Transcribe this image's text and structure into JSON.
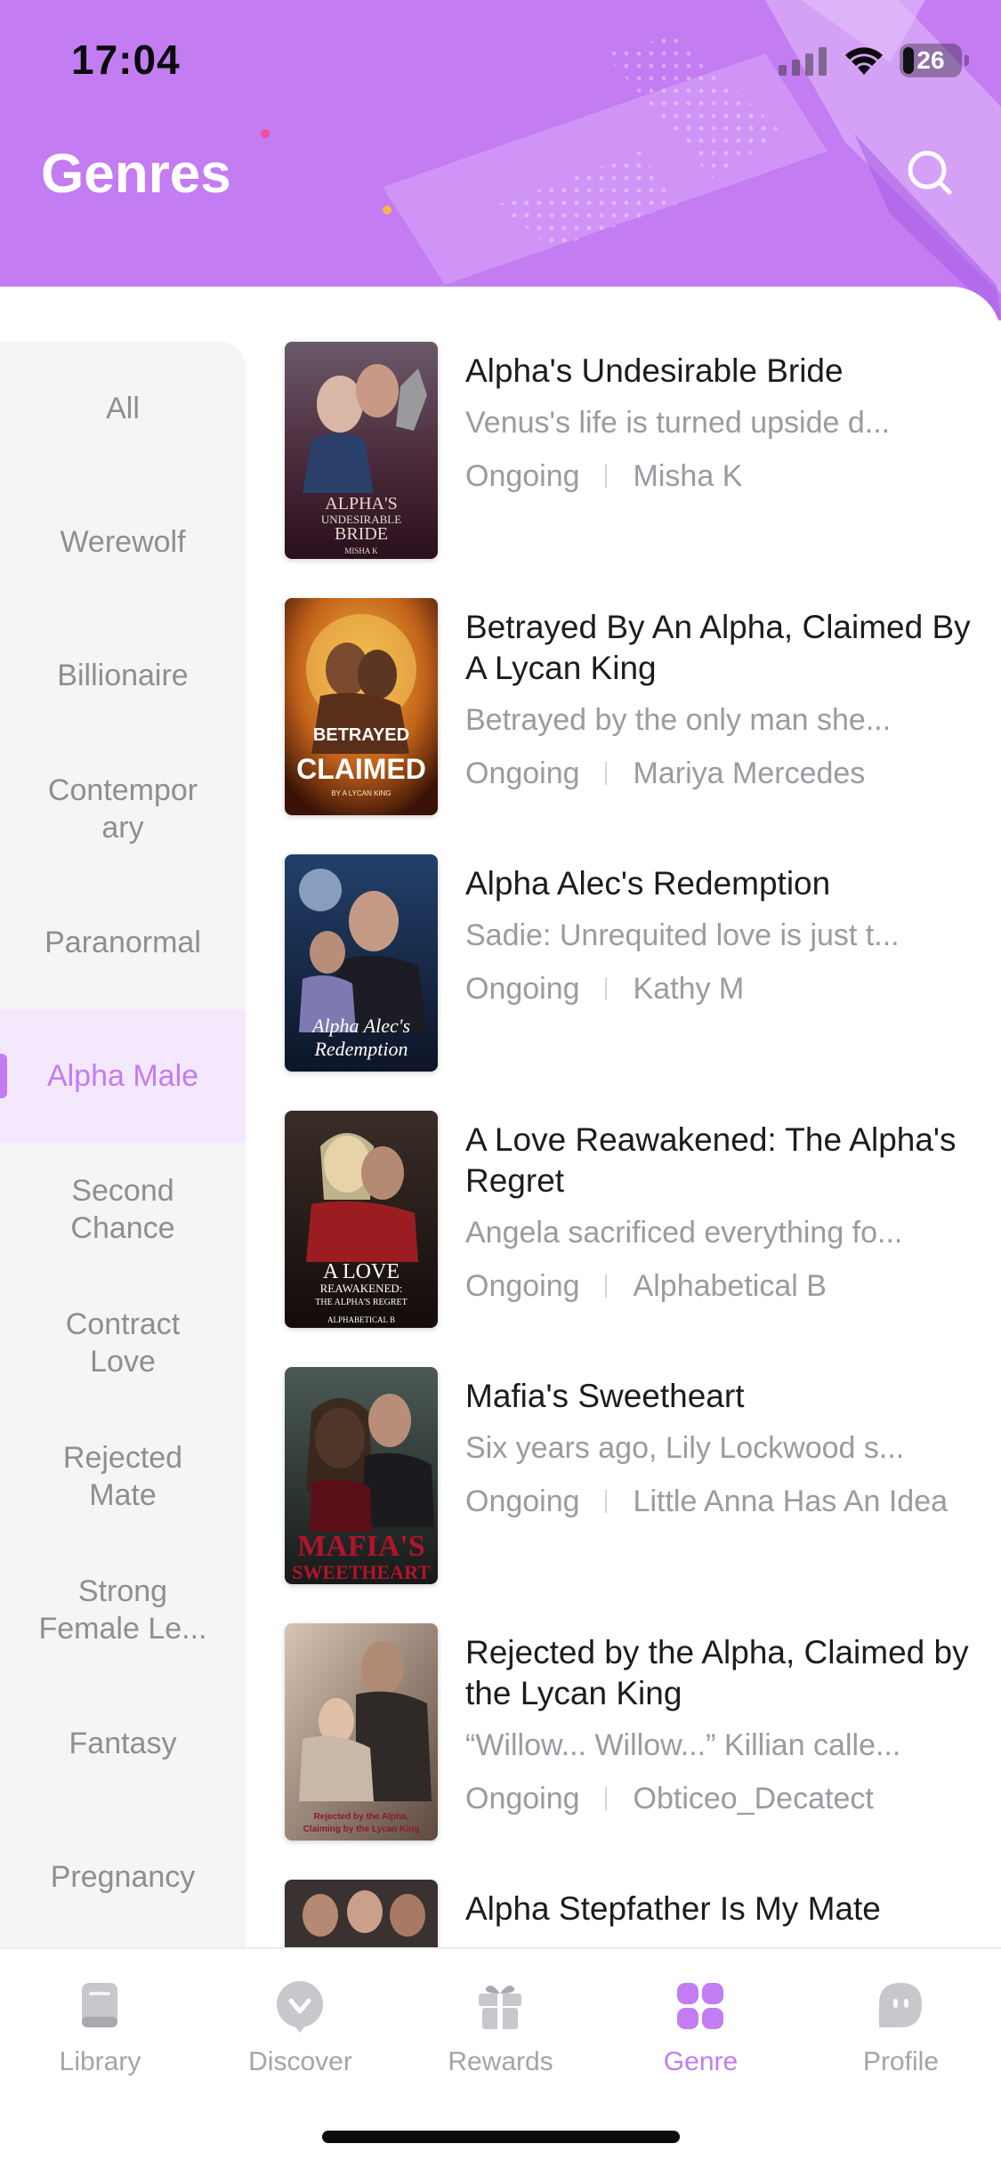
{
  "status_bar": {
    "time": "17:04",
    "battery": "26"
  },
  "header": {
    "title": "Genres",
    "search_icon": "search-icon"
  },
  "colors": {
    "accent": "#c37cf2",
    "header_bg": "#c37cf2",
    "active_tab_bg": "#f4e8fd",
    "muted_text": "#9a9aa0"
  },
  "categories": [
    {
      "label": "All"
    },
    {
      "label": "Werewolf"
    },
    {
      "label": "Billionaire"
    },
    {
      "label": "Contempor ary"
    },
    {
      "label": "Paranormal"
    },
    {
      "label": "Alpha Male",
      "selected": true
    },
    {
      "label": "Second Chance"
    },
    {
      "label": "Contract Love"
    },
    {
      "label": "Rejected Mate"
    },
    {
      "label": "Strong Female Le..."
    },
    {
      "label": "Fantasy"
    },
    {
      "label": "Pregnancy"
    }
  ],
  "books": [
    {
      "title": "Alpha's Undesirable Bride",
      "description": "Venus's life is turned upside d...",
      "status": "Ongoing",
      "author": "Misha K"
    },
    {
      "title": "Betrayed By An Alpha, Claimed By A Lycan King",
      "description": "Betrayed by the only man she...",
      "status": "Ongoing",
      "author": "Mariya Mercedes"
    },
    {
      "title": "Alpha Alec's Redemption",
      "description": "Sadie: Unrequited love is just t...",
      "status": "Ongoing",
      "author": "Kathy M"
    },
    {
      "title": "A Love Reawakened: The Alpha's Regret",
      "description": "Angela sacrificed everything fo...",
      "status": "Ongoing",
      "author": "Alphabetical B"
    },
    {
      "title": "Mafia's Sweetheart",
      "description": "Six years ago, Lily Lockwood s...",
      "status": "Ongoing",
      "author": "Little Anna Has An Idea"
    },
    {
      "title": "Rejected by the Alpha, Claimed by the Lycan King",
      "description": "“Willow... Willow...” Killian calle...",
      "status": "Ongoing",
      "author": "Obticeo_Decatect"
    },
    {
      "title": "Alpha Stepfather Is My Mate"
    }
  ],
  "tabs": [
    {
      "label": "Library",
      "icon": "book-icon"
    },
    {
      "label": "Discover",
      "icon": "compass-icon"
    },
    {
      "label": "Rewards",
      "icon": "gift-icon"
    },
    {
      "label": "Genre",
      "icon": "grid-icon",
      "active": true
    },
    {
      "label": "Profile",
      "icon": "profile-icon"
    }
  ]
}
